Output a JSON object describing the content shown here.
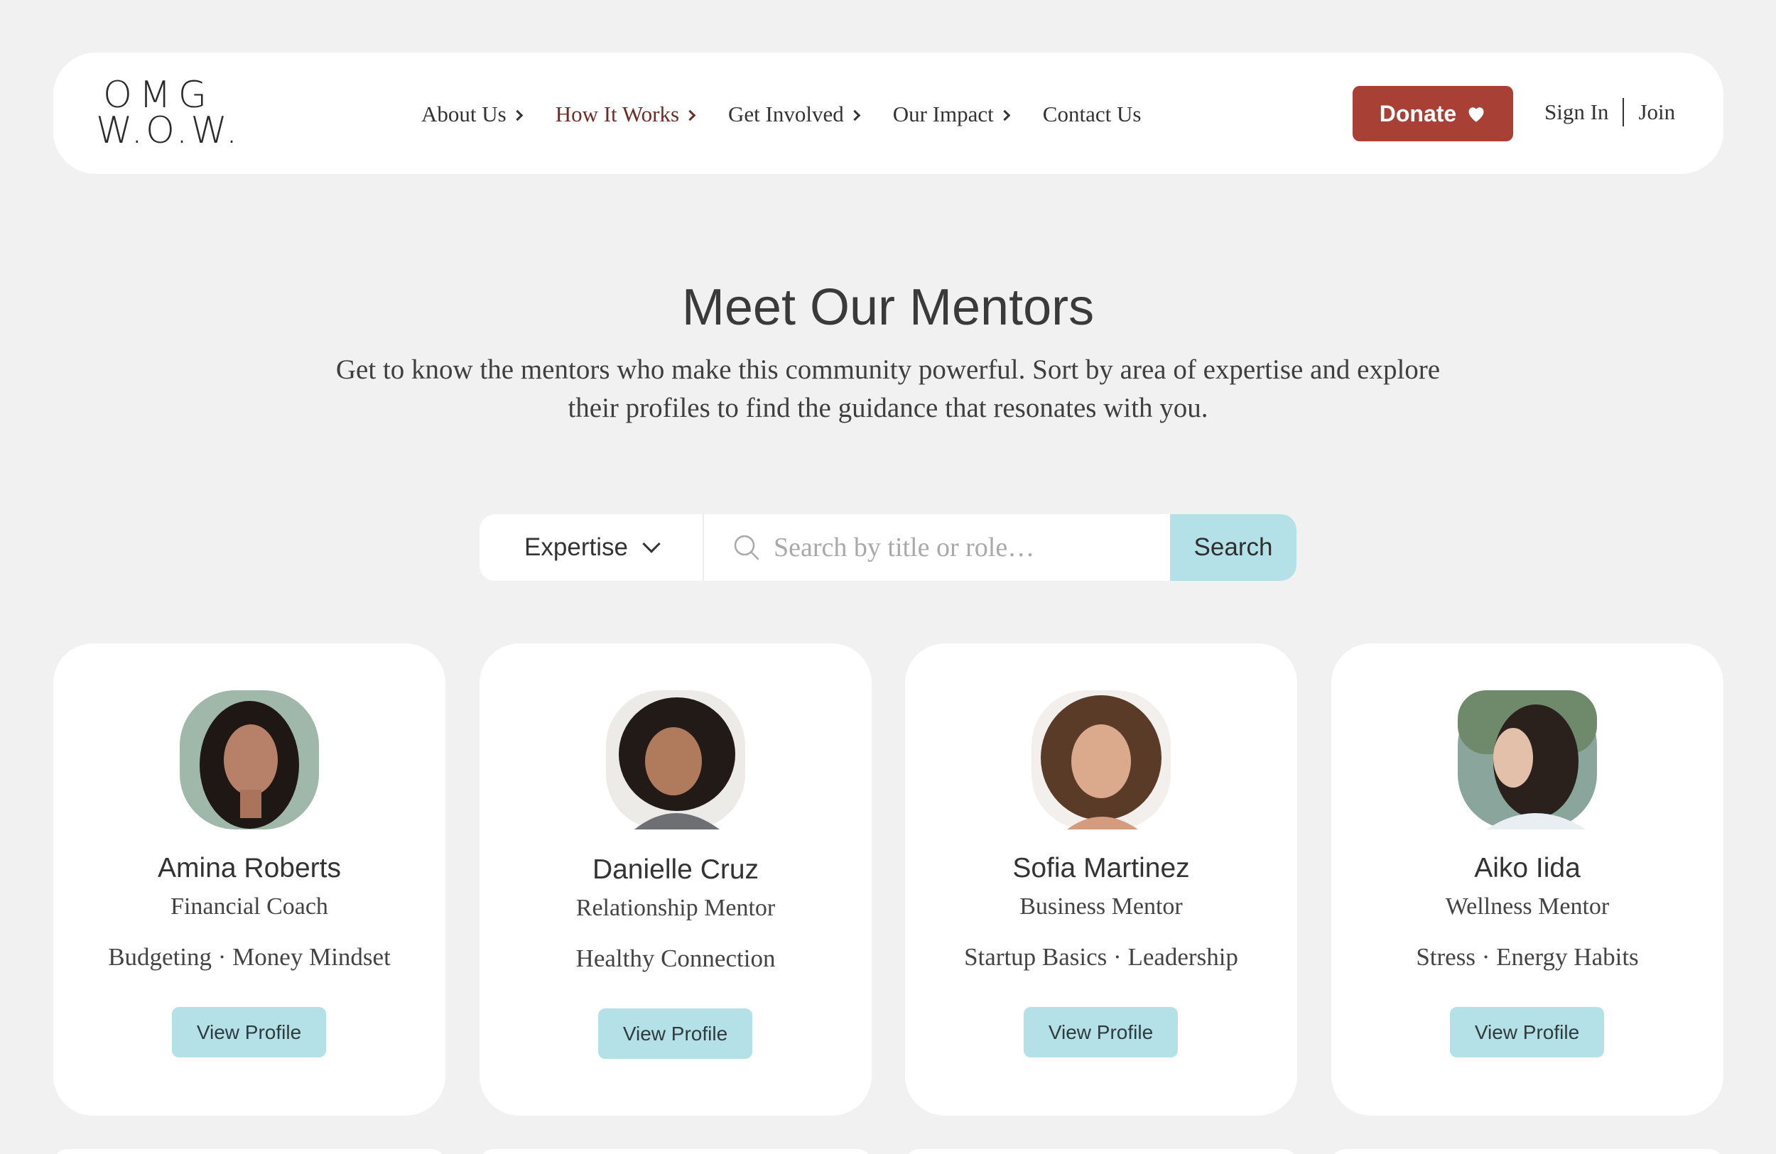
{
  "logo": {
    "line1": "OMG",
    "line2": "W.O.W."
  },
  "nav": {
    "items": [
      {
        "label": "About Us",
        "has_chevron": true
      },
      {
        "label": "How It Works",
        "has_chevron": true,
        "active": true
      },
      {
        "label": "Get Involved",
        "has_chevron": true
      },
      {
        "label": "Our Impact",
        "has_chevron": true
      },
      {
        "label": "Contact Us",
        "has_chevron": false
      }
    ],
    "donate_label": "Donate",
    "sign_in": "Sign In",
    "join": "Join"
  },
  "hero": {
    "title": "Meet Our Mentors",
    "subtitle": "Get to know the mentors who make this community powerful. Sort by area of expertise and explore their profiles to find the guidance that resonates with you."
  },
  "search": {
    "filter_label": "Expertise",
    "placeholder": "Search by title or role…",
    "button_label": "Search"
  },
  "mentors": [
    {
      "name": "Amina Roberts",
      "role": "Financial Coach",
      "tags": "Budgeting · Money Mindset",
      "button": "View Profile"
    },
    {
      "name": "Danielle Cruz",
      "role": "Relationship Mentor",
      "tags": "Healthy Connection",
      "button": "View Profile"
    },
    {
      "name": "Sofia Martinez",
      "role": "Business Mentor",
      "tags": "Startup Basics · Leadership",
      "button": "View Profile"
    },
    {
      "name": "Aiko Iida",
      "role": "Wellness Mentor",
      "tags": "Stress · Energy Habits",
      "button": "View Profile"
    }
  ],
  "colors": {
    "background": "#f1f1f1",
    "donate": "#a84035",
    "accent_teal": "#b3e1e7",
    "active_nav": "#6e2c24"
  }
}
